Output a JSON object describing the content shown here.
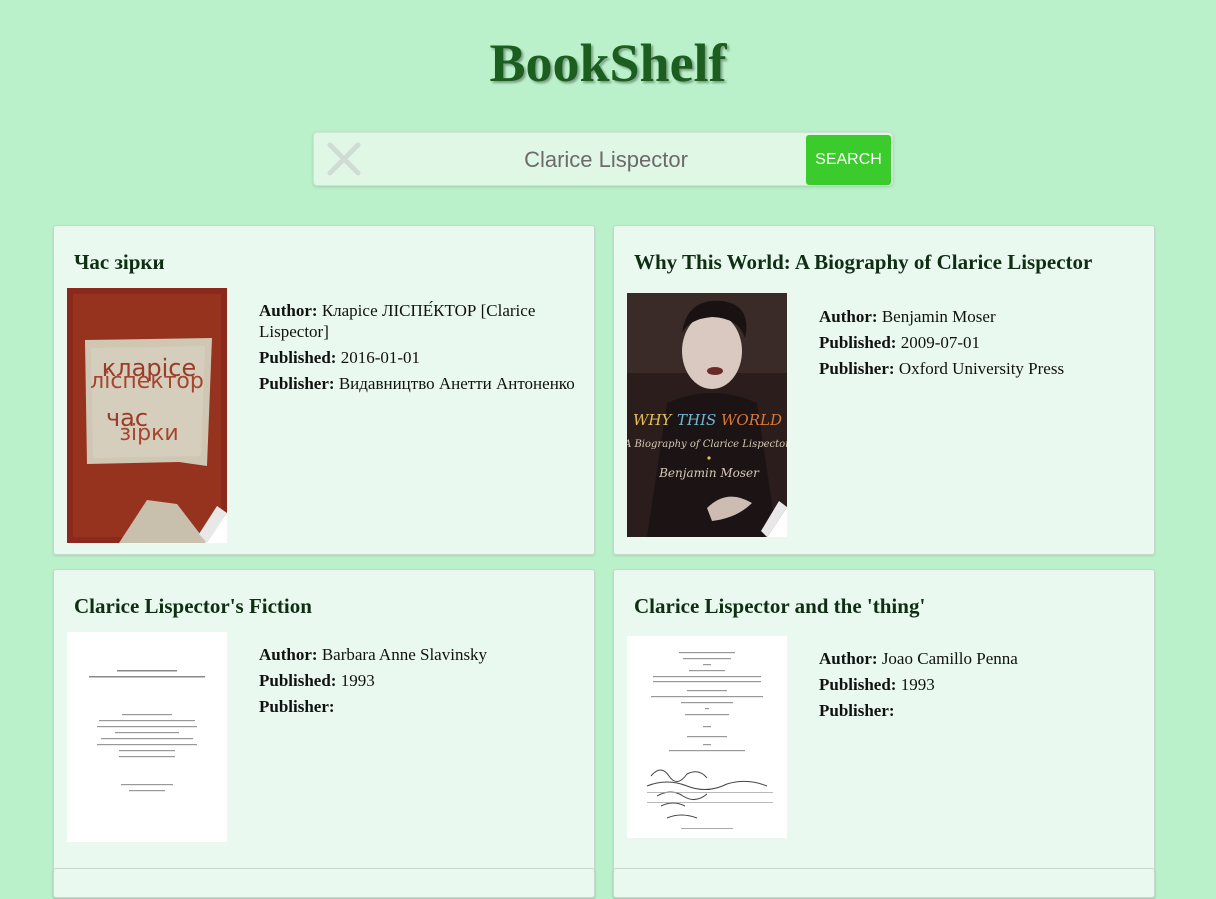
{
  "app": {
    "title": "BookShelf"
  },
  "search": {
    "value": "Clarice Lispector",
    "button_label": "SEARCH"
  },
  "labels": {
    "author": "Author:",
    "published": "Published:",
    "publisher": "Publisher:"
  },
  "books": [
    {
      "title": "Час зірки",
      "author": "Кларісе ЛІСПЕ́КТОР [Clarice Lispector]",
      "published": "2016-01-01",
      "publisher": "Видавництво Анетти Антоненко",
      "cover": {
        "line1": "кларісе",
        "line2": "ліспектор",
        "line3": "час",
        "line4": "зірки"
      }
    },
    {
      "title": "Why This World: A Biography of Clarice Lispector",
      "author": "Benjamin Moser",
      "published": "2009-07-01",
      "publisher": "Oxford University Press",
      "cover": {
        "word1": "WHY",
        "word2": "THIS",
        "word3": "WORLD",
        "subtitle": "A Biography of Clarice Lispector",
        "author": "Benjamin Moser"
      }
    },
    {
      "title": "Clarice Lispector's Fiction",
      "author": "Barbara Anne Slavinsky",
      "published": "1993",
      "publisher": ""
    },
    {
      "title": "Clarice Lispector and the 'thing'",
      "author": "Joao Camillo Penna",
      "published": "1993",
      "publisher": ""
    }
  ]
}
